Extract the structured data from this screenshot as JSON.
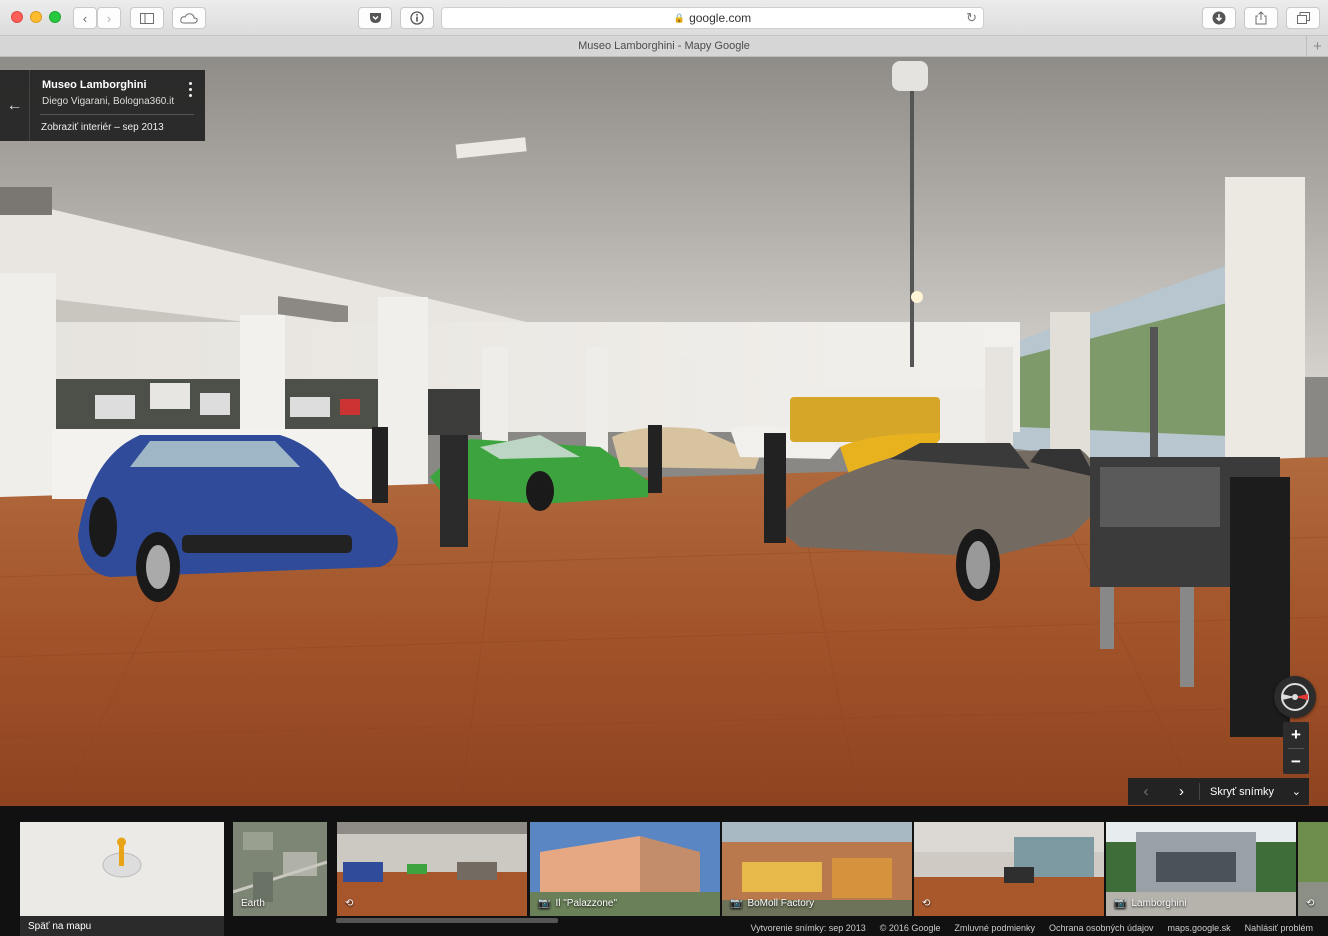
{
  "browser": {
    "url": "google.com",
    "tab_title": "Museo Lamborghini - Mapy Google"
  },
  "infocard": {
    "title": "Museo Lamborghini",
    "subtitle": "Diego Vigarani, Bologna360.it",
    "date_link": "Zobraziť interiér – sep 2013"
  },
  "strip_controls": {
    "hide_label": "Skryť snímky"
  },
  "filmstrip": {
    "back_to_map": "Späť na mapu",
    "thumbnails": [
      {
        "label": "Earth",
        "icon": "none"
      },
      {
        "label": "",
        "icon": "360-icon",
        "selected": true
      },
      {
        "label": "Il \"Palazzone\"",
        "icon": "camera-icon"
      },
      {
        "label": "BoMoll Factory",
        "icon": "camera-icon"
      },
      {
        "label": "",
        "icon": "360-icon"
      },
      {
        "label": "Lamborghini",
        "icon": "camera-icon"
      },
      {
        "label": "",
        "icon": "360-icon"
      }
    ]
  },
  "footer": {
    "capture": "Vytvorenie snímky: sep 2013",
    "copyright": "© 2016 Google",
    "terms": "Zmluvné podmienky",
    "privacy": "Ochrana osobných údajov",
    "domain": "maps.google.sk",
    "report": "Nahlásiť problém"
  },
  "colors": {
    "floor": "#a0522d",
    "ceiling": "#c8c4c0",
    "panel": "#222222",
    "accent_red": "#e53935"
  }
}
